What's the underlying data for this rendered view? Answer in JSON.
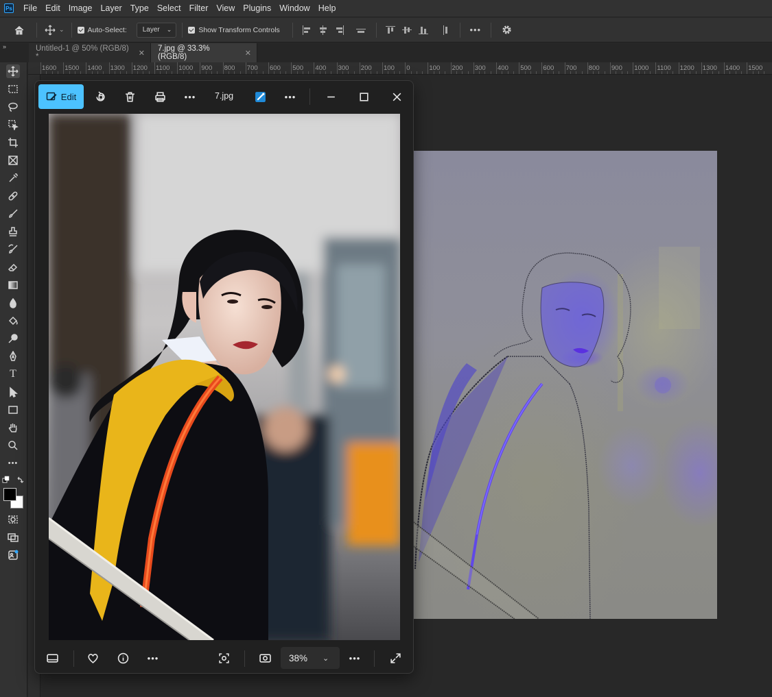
{
  "app": {
    "logo": "Ps",
    "menus": [
      "File",
      "Edit",
      "Image",
      "Layer",
      "Type",
      "Select",
      "Filter",
      "View",
      "Plugins",
      "Window",
      "Help"
    ]
  },
  "options": {
    "auto_select_label": "Auto-Select:",
    "auto_select_checked": true,
    "layer_select_value": "Layer",
    "show_transform_label": "Show Transform Controls",
    "show_transform_checked": true,
    "more_label": "•••"
  },
  "tabs": [
    {
      "label": "Untitled-1 @ 50% (RGB/8) *",
      "active": false
    },
    {
      "label": "7.jpg @ 33.3% (RGB/8)",
      "active": true
    }
  ],
  "ruler": {
    "labels": [
      "1600",
      "1500",
      "1400",
      "1300",
      "1200",
      "1100",
      "1000",
      "900",
      "800",
      "700",
      "600",
      "500",
      "400",
      "300",
      "200",
      "100",
      "0",
      "100",
      "200",
      "300",
      "400",
      "500",
      "600",
      "700",
      "800",
      "900",
      "1000",
      "1100",
      "1200",
      "1300",
      "1400",
      "1500"
    ]
  },
  "toolbar": {
    "expand_label": "»",
    "more_tools": "•••"
  },
  "photos_viewer": {
    "edit_label": "Edit",
    "filename": "7.jpg",
    "more_label": "•••",
    "zoom_value": "38%",
    "minimize_glyph": "—",
    "close_glyph": "✕"
  },
  "colors": {
    "accent": "#4cc2ff",
    "ps_blue": "#31a8ff",
    "foreground_swatch": "#000000",
    "background_swatch": "#ffffff"
  }
}
